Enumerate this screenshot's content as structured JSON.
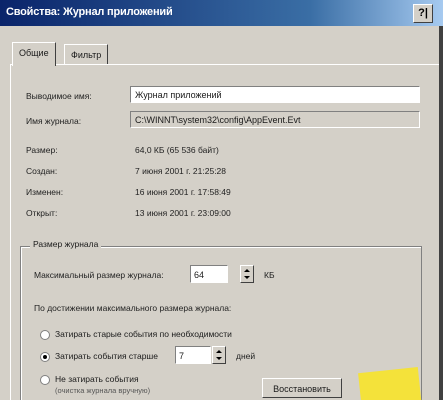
{
  "window": {
    "title": "Свойства: Журнал приложений",
    "help_label": "?|"
  },
  "tabs": [
    {
      "label": "Общие",
      "active": true
    },
    {
      "label": "Фильтр",
      "active": false
    }
  ],
  "general": {
    "display_name_label": "Выводимое имя:",
    "display_name_value": "Журнал приложений",
    "log_name_label": "Имя журнала:",
    "log_name_value": "C:\\WINNT\\system32\\config\\AppEvent.Evt",
    "size_label": "Размер:",
    "size_value": "64,0 КБ (65 536 байт)",
    "created_label": "Создан:",
    "created_value": "7 июня 2001 г. 21:25:28",
    "modified_label": "Изменен:",
    "modified_value": "16 июня 2001 г. 17:58:49",
    "accessed_label": "Открыт:",
    "accessed_value": "13 июня 2001 г. 23:09:00"
  },
  "log_size": {
    "group_title": "Размер журнала",
    "max_size_label": "Максимальный размер журнала:",
    "max_size_value": "64",
    "max_size_unit": "КБ",
    "on_max_text": "По достижении максимального размера журнала:",
    "options": [
      {
        "label": "Затирать старые события по необходимости",
        "checked": false
      },
      {
        "label": "Затирать события старше",
        "checked": true
      },
      {
        "label": "Не затирать события",
        "checked": false
      }
    ],
    "days_value": "7",
    "days_unit": "дней",
    "not_overwrite_sub": "(очистка журнала вручную)",
    "restore_defaults_label": "Восстановить"
  },
  "colors": {
    "title_gradient_start": "#0a246a",
    "title_gradient_end": "#a6caf0",
    "dialog_face": "#d4d0c8",
    "sticker": "#f4e23a"
  }
}
